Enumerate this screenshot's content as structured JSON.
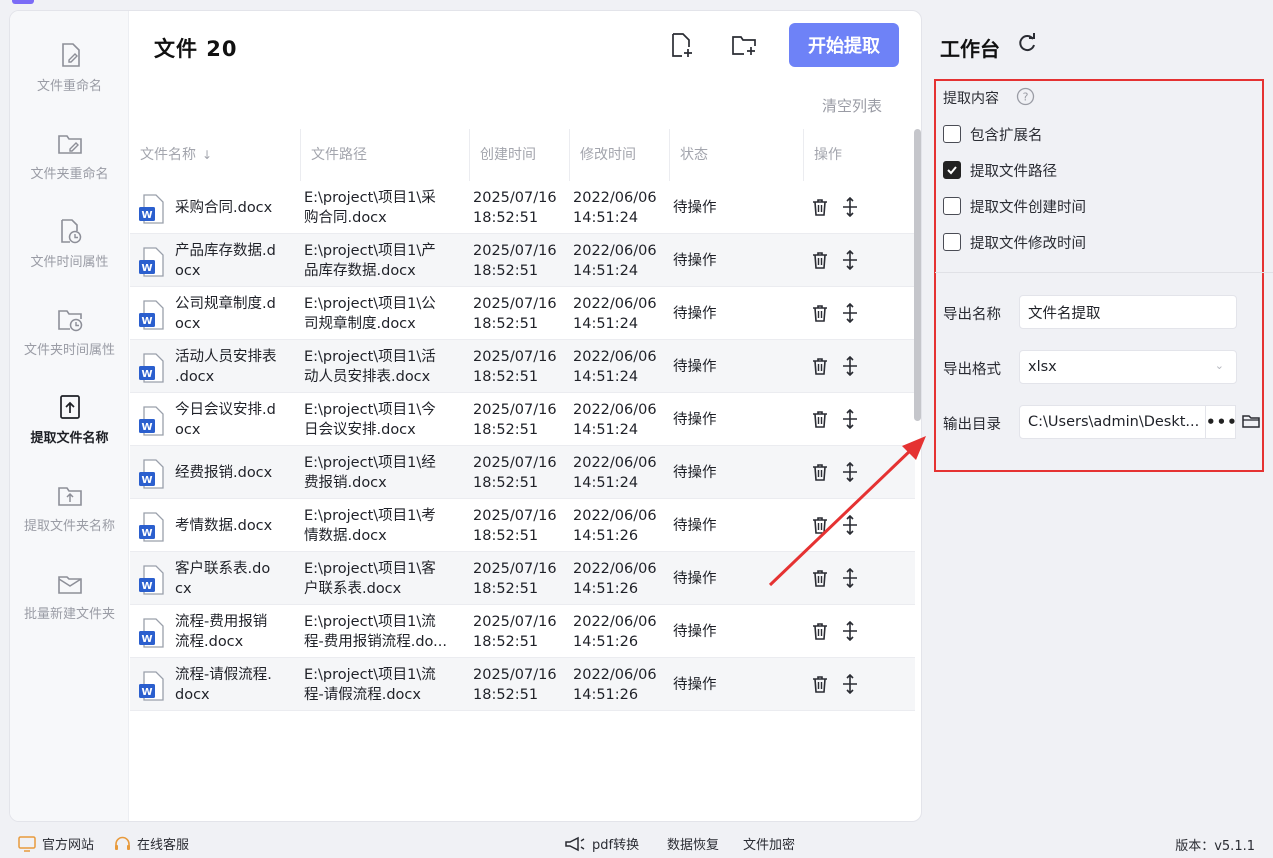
{
  "sidebar": {
    "items": [
      {
        "label": "文件重命名",
        "icon": "file-edit-icon",
        "active": false
      },
      {
        "label": "文件夹重命名",
        "icon": "folder-edit-icon",
        "active": false
      },
      {
        "label": "文件时间属性",
        "icon": "file-clock-icon",
        "active": false
      },
      {
        "label": "文件夹时间属性",
        "icon": "folder-clock-icon",
        "active": false
      },
      {
        "label": "提取文件名称",
        "icon": "file-upload-icon",
        "active": true
      },
      {
        "label": "提取文件夹名称",
        "icon": "folder-upload-icon",
        "active": false
      },
      {
        "label": "批量新建文件夹",
        "icon": "folder-mail-icon",
        "active": false
      }
    ]
  },
  "header": {
    "title": "文件 20",
    "start_button": "开始提取",
    "clear_list": "清空列表",
    "add_file_icon": "add-file-icon",
    "add_folder_icon": "add-folder-icon"
  },
  "table": {
    "columns": [
      "文件名称",
      "文件路径",
      "创建时间",
      "修改时间",
      "状态",
      "操作"
    ],
    "rows": [
      {
        "name": "采购合同.docx",
        "path": "E:\\project\\项目1\\采\n购合同.docx",
        "created": "2025/07/16\n18:52:51",
        "modified": "2022/06/06\n14:51:24",
        "status": "待操作"
      },
      {
        "name": "产品库存数据.d\nocx",
        "path": "E:\\project\\项目1\\产\n品库存数据.docx",
        "created": "2025/07/16\n18:52:51",
        "modified": "2022/06/06\n14:51:24",
        "status": "待操作"
      },
      {
        "name": "公司规章制度.d\nocx",
        "path": "E:\\project\\项目1\\公\n司规章制度.docx",
        "created": "2025/07/16\n18:52:51",
        "modified": "2022/06/06\n14:51:24",
        "status": "待操作"
      },
      {
        "name": "活动人员安排表\n.docx",
        "path": "E:\\project\\项目1\\活\n动人员安排表.docx",
        "created": "2025/07/16\n18:52:51",
        "modified": "2022/06/06\n14:51:24",
        "status": "待操作"
      },
      {
        "name": "今日会议安排.d\nocx",
        "path": "E:\\project\\项目1\\今\n日会议安排.docx",
        "created": "2025/07/16\n18:52:51",
        "modified": "2022/06/06\n14:51:24",
        "status": "待操作"
      },
      {
        "name": "经费报销.docx",
        "path": "E:\\project\\项目1\\经\n费报销.docx",
        "created": "2025/07/16\n18:52:51",
        "modified": "2022/06/06\n14:51:24",
        "status": "待操作"
      },
      {
        "name": "考情数据.docx",
        "path": "E:\\project\\项目1\\考\n情数据.docx",
        "created": "2025/07/16\n18:52:51",
        "modified": "2022/06/06\n14:51:26",
        "status": "待操作"
      },
      {
        "name": "客户联系表.do\ncx",
        "path": "E:\\project\\项目1\\客\n户联系表.docx",
        "created": "2025/07/16\n18:52:51",
        "modified": "2022/06/06\n14:51:26",
        "status": "待操作"
      },
      {
        "name": "流程-费用报销\n流程.docx",
        "path": "E:\\project\\项目1\\流\n程-费用报销流程.do...",
        "created": "2025/07/16\n18:52:51",
        "modified": "2022/06/06\n14:51:26",
        "status": "待操作"
      },
      {
        "name": "流程-请假流程.\ndocx",
        "path": "E:\\project\\项目1\\流\n程-请假流程.docx",
        "created": "2025/07/16\n18:52:51",
        "modified": "2022/06/06\n14:51:26",
        "status": "待操作"
      }
    ]
  },
  "workspace": {
    "title": "工作台",
    "section_title": "提取内容",
    "options": [
      {
        "label": "包含扩展名",
        "checked": false
      },
      {
        "label": "提取文件路径",
        "checked": true
      },
      {
        "label": "提取文件创建时间",
        "checked": false
      },
      {
        "label": "提取文件修改时间",
        "checked": false
      }
    ],
    "export_name_label": "导出名称",
    "export_name_value": "文件名提取",
    "export_format_label": "导出格式",
    "export_format_value": "xlsx",
    "output_dir_label": "输出目录",
    "output_dir_value": "C:\\Users\\admin\\Deskt...",
    "dots": "•••"
  },
  "footer": {
    "official_site": "官方网站",
    "online_service": "在线客服",
    "pdf_convert": "pdf转换",
    "data_recovery": "数据恢复",
    "file_encrypt": "文件加密",
    "version": "版本：v5.1.1"
  },
  "colors": {
    "accent": "#6e82f7",
    "highlight_red": "#e53232",
    "word_blue": "#2b5fce"
  }
}
